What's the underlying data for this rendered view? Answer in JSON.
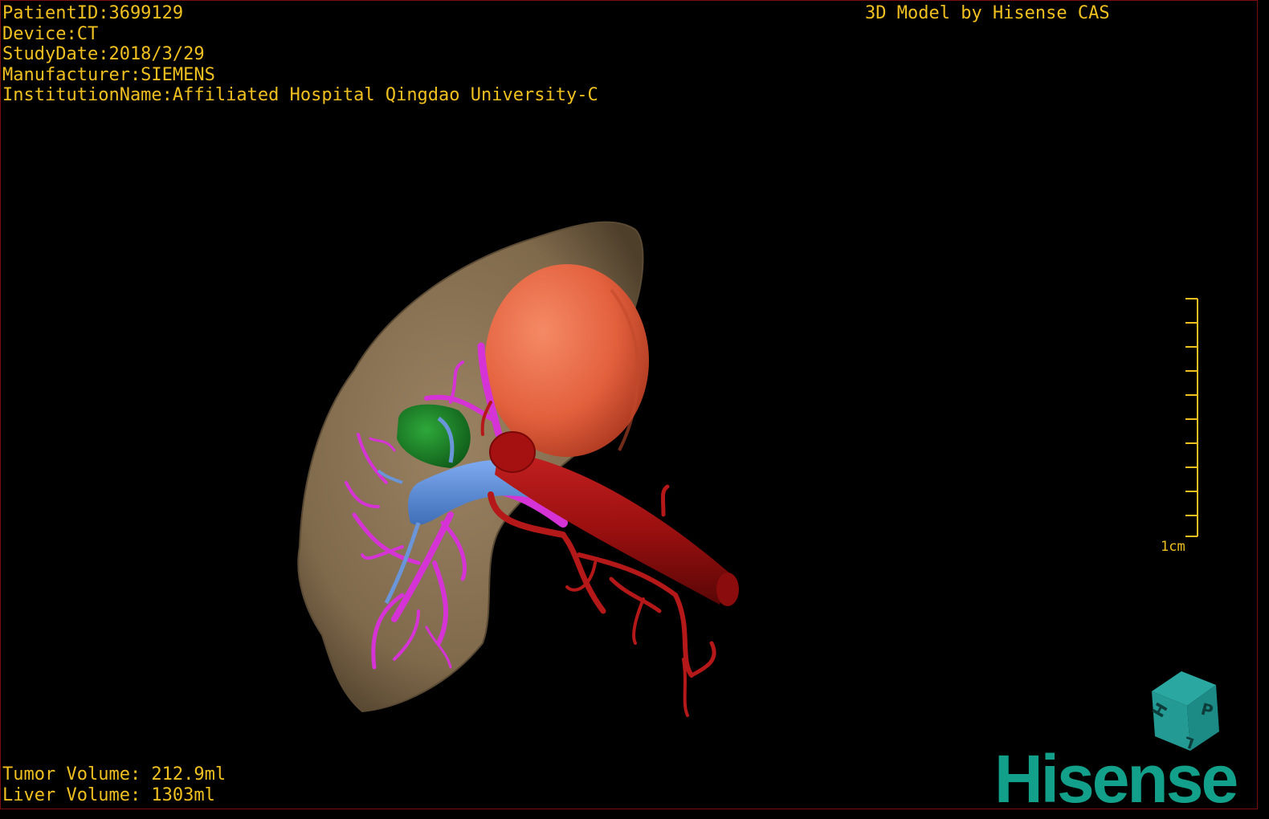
{
  "patient_info": {
    "patient_id": "PatientID:3699129",
    "device": "Device:CT",
    "study_date": "StudyDate:2018/3/29",
    "manufacturer": "Manufacturer:SIEMENS",
    "institution": "InstitutionName:Affiliated Hospital Qingdao University-C"
  },
  "credit": "3D Model by Hisense CAS",
  "volumes": {
    "tumor": "Tumor Volume: 212.9ml",
    "liver": "Liver Volume: 1303ml"
  },
  "scale_bar": {
    "label": "1cm"
  },
  "orientation_cube": {
    "labels": [
      "P",
      "H",
      "L"
    ]
  },
  "brand_logo": "Hisense",
  "colors": {
    "overlay_text": "#f0c020",
    "liver": "#8a7254",
    "tumor": "#e8603c",
    "portal_vein": "#d633d6",
    "hepatic_vein": "#5b8fd8",
    "artery": "#b51818",
    "gallbladder": "#1f8a2a",
    "brand": "#12a08a"
  }
}
